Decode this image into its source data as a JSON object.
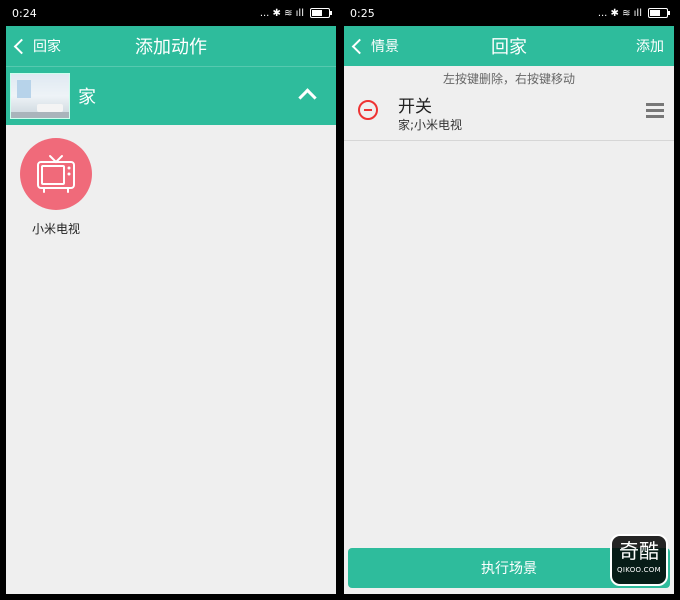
{
  "left": {
    "status": {
      "time": "0:24",
      "icons": "... ✱ ≋ ıll"
    },
    "appbar": {
      "back_label": "回家",
      "title": "添加动作"
    },
    "room": {
      "name": "家"
    },
    "devices": [
      {
        "label": "小米电视"
      }
    ]
  },
  "right": {
    "status": {
      "time": "0:25",
      "icons": "... ✱ ≋ ıll"
    },
    "appbar": {
      "back_label": "情景",
      "title": "回家",
      "action_label": "添加"
    },
    "hint": "左按键删除，右按键移动",
    "actions": [
      {
        "title": "开关",
        "subtitle": "家;小米电视"
      }
    ],
    "run_button": "执行场景"
  },
  "watermark": {
    "big": "奇酷",
    "small": "QIKOO.COM"
  },
  "colors": {
    "accent": "#2ebc9c",
    "device_bg": "#f06a7a",
    "remove": "#ee3333"
  }
}
